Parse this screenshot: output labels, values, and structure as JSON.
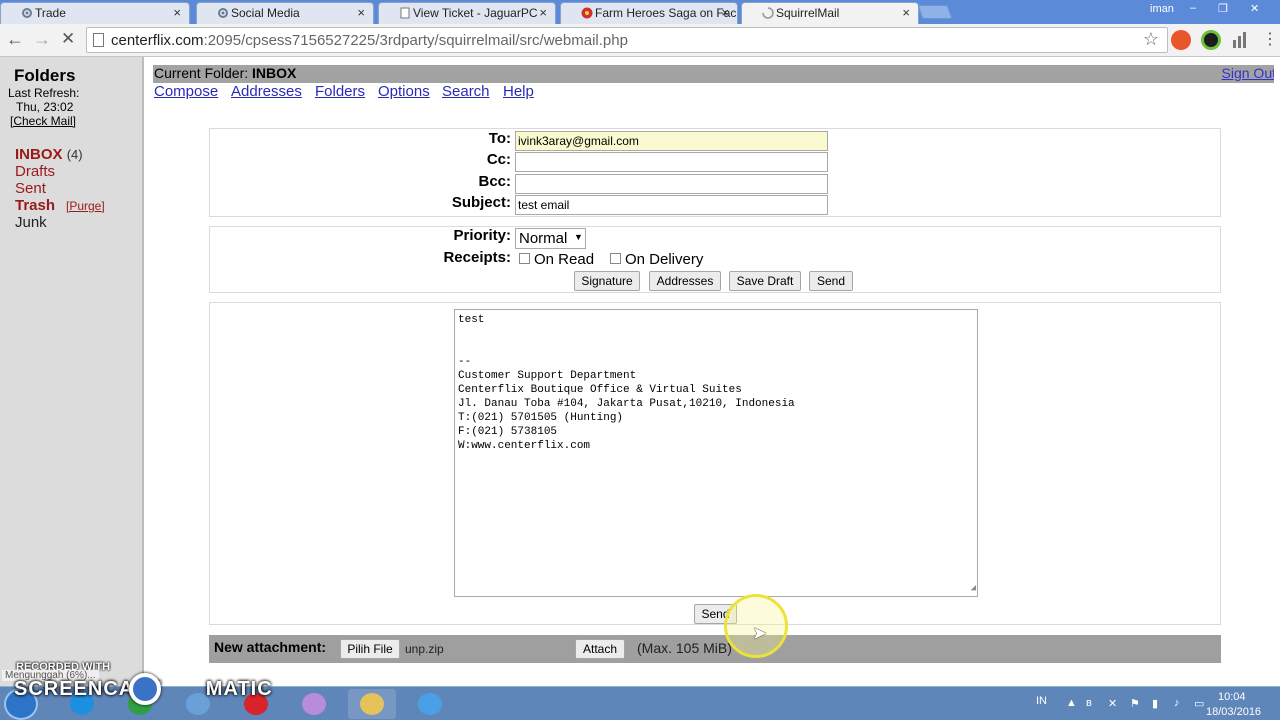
{
  "browser": {
    "tabs": [
      {
        "label": "Trade",
        "icon": "gear-icon",
        "icon_color": "#6b7c93"
      },
      {
        "label": "Social Media",
        "icon": "gear-icon",
        "icon_color": "#6b7c93"
      },
      {
        "label": "View Ticket - JaguarPC",
        "icon": "page-icon",
        "icon_color": "#888888"
      },
      {
        "label": "Farm Heroes Saga on Fac",
        "icon": "farm-heroes-icon",
        "icon_color": "#d03030"
      },
      {
        "label": "SquirrelMail",
        "icon": "loading-icon",
        "icon_color": "#999999"
      }
    ],
    "window_user": "iman",
    "window_buttons": [
      "–",
      "❐",
      "✕"
    ],
    "nav": {
      "back": "←",
      "forward": "→",
      "stop": "✕"
    },
    "url_host": "centerflix.com",
    "url_path": ":2095/cpsess7156527225/3rdparty/squirrelmail/src/webmail.php",
    "bookmark_star": "☆",
    "menu_icon": "⋮"
  },
  "left": {
    "title": "Folders",
    "last_refresh_label": "Last Refresh:",
    "refresh_time": "Thu, 23:02",
    "check_mail": "[Check Mail]",
    "folders": {
      "inbox": "INBOX",
      "inbox_count": "(4)",
      "drafts": "Drafts",
      "sent": "Sent",
      "trash": "Trash",
      "purge": "[Purge]",
      "junk": "Junk"
    }
  },
  "main": {
    "current_folder_label": "Current Folder:",
    "current_folder": "INBOX",
    "sign_out": "Sign Out",
    "menu": [
      "Compose",
      "Addresses",
      "Folders",
      "Options",
      "Search",
      "Help"
    ],
    "fields": {
      "to_label": "To:",
      "to_value": "ivink3aray@gmail.com",
      "cc_label": "Cc:",
      "cc_value": "",
      "bcc_label": "Bcc:",
      "bcc_value": "",
      "subject_label": "Subject:",
      "subject_value": "test email"
    },
    "options": {
      "priority_label": "Priority:",
      "priority_value": "Normal",
      "receipts_label": "Receipts:",
      "on_read": "On Read",
      "on_delivery": "On Delivery"
    },
    "buttons": {
      "signature": "Signature",
      "addresses": "Addresses",
      "save_draft": "Save Draft",
      "send": "Send"
    },
    "body": "test\n\n\n--\nCustomer Support Department\nCenterflix Boutique Office & Virtual Suites\nJl. Danau Toba #104, Jakarta Pusat,10210, Indonesia\nT:(021) 5701505 (Hunting)\nF:(021) 5738105\nW:www.centerflix.com",
    "send_bottom": "Send",
    "attachment": {
      "label": "New attachment:",
      "choose_file": "Pilih File",
      "file_name": "unp.zip",
      "attach": "Attach",
      "max_size": "(Max. 105 MiB)"
    }
  },
  "overlay": {
    "recorded_with": "RECORDED WITH",
    "status": "Mengunggah (6%)...",
    "logo": "SCREENCAST",
    "logo_suffix": "MATIC"
  },
  "taskbar": {
    "apps": [
      {
        "name": "internet-explorer-icon",
        "color": "#1d8fe0"
      },
      {
        "name": "chrome-icon",
        "color": "#2f9e44"
      },
      {
        "name": "app-icon",
        "color": "#6aa0d8"
      },
      {
        "name": "opera-icon",
        "color": "#d8232a"
      },
      {
        "name": "media-icon",
        "color": "#b78cd8"
      },
      {
        "name": "folder-icon",
        "color": "#e6c35a"
      },
      {
        "name": "media-player-icon",
        "color": "#4aa0e8"
      }
    ],
    "lang": "IN",
    "time": "10:04",
    "date": "18/03/2016"
  },
  "colors": {
    "tabbar": "#5b8ad8",
    "folder_link": "#9a1a1a",
    "menu_link": "#2a2ab8",
    "header_bar": "#a3a3a3",
    "to_highlight": "#fafad0"
  }
}
